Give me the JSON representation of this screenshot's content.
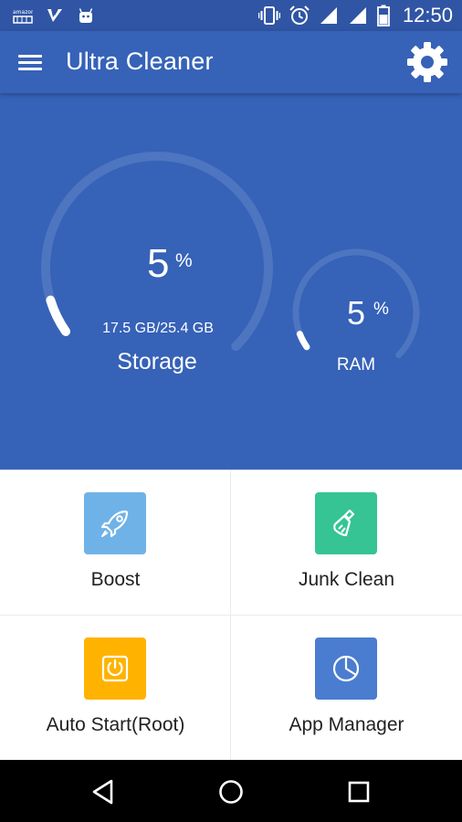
{
  "status_bar": {
    "left_icons": [
      "amazon-icon",
      "checkmark-notification-icon",
      "android-icon"
    ],
    "right_icons": [
      "vibrate-icon",
      "alarm-icon",
      "signal-icon",
      "signal-icon",
      "battery-icon"
    ],
    "time": "12:50"
  },
  "app_bar": {
    "title": "Ultra Cleaner",
    "menu_icon": "hamburger-menu-icon",
    "settings_icon": "gear-icon"
  },
  "storage": {
    "percent": "5",
    "percent_sign": "%",
    "detail": "17.5 GB/25.4 GB",
    "label": "Storage",
    "fill_fraction": 0.05
  },
  "ram": {
    "percent": "5",
    "percent_sign": "%",
    "label": "RAM",
    "fill_fraction": 0.05
  },
  "tools": [
    {
      "label": "Boost",
      "icon": "rocket-icon",
      "color": "#6fb2e8"
    },
    {
      "label": "Junk Clean",
      "icon": "broom-icon",
      "color": "#36c495"
    },
    {
      "label": "Auto Start(Root)",
      "icon": "power-icon",
      "color": "#ffb300"
    },
    {
      "label": "App Manager",
      "icon": "pie-chart-icon",
      "color": "#4a7cd0"
    }
  ],
  "colors": {
    "primary": "#3662b8",
    "status_bar": "#2f55a4"
  },
  "nav_bar": {
    "icons": [
      "back-triangle-icon",
      "home-circle-icon",
      "recents-square-icon"
    ]
  }
}
